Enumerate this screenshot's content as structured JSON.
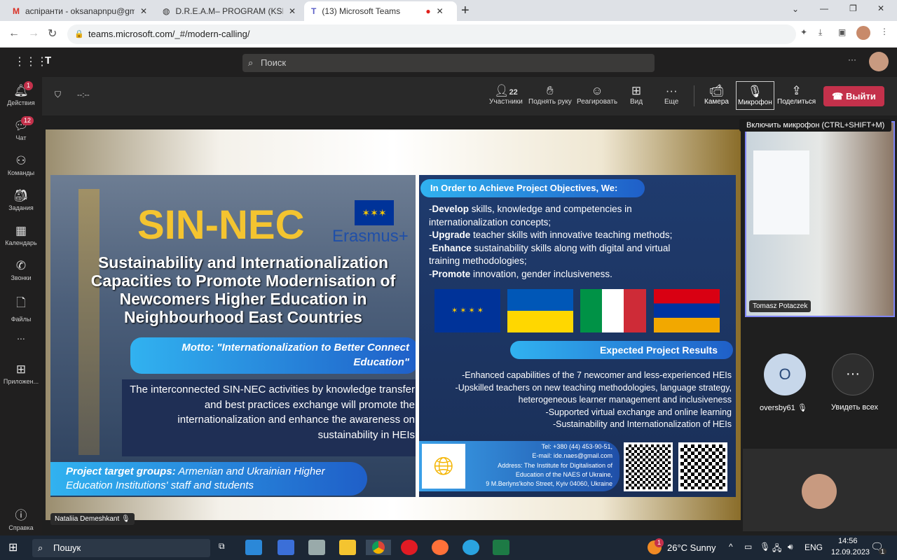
{
  "browser": {
    "tabs": [
      {
        "label": "аспіранти - oksanapnpu@gmail.",
        "icon": "gmail-icon"
      },
      {
        "label": "D.R.E.A.M– PROGRAM (KSIĄŻECZ",
        "icon": "globe-icon"
      },
      {
        "label": "(13) Microsoft Teams",
        "icon": "teams-icon",
        "active": true
      }
    ],
    "url": "teams.microsoft.com/_#/modern-calling/"
  },
  "teams": {
    "search_placeholder": "Поиск",
    "rail": [
      {
        "label": "Действия",
        "badge": "1"
      },
      {
        "label": "Чат",
        "badge": "12"
      },
      {
        "label": "Команды"
      },
      {
        "label": "Задания"
      },
      {
        "label": "Календарь"
      },
      {
        "label": "Звонки"
      },
      {
        "label": "Файлы"
      },
      {
        "label": "..."
      },
      {
        "label": "Приложен..."
      },
      {
        "label": "Справка"
      }
    ],
    "timer": "--:--",
    "toolbar": {
      "participants_count": "22",
      "participants": "Участники",
      "raise_hand": "Поднять руку",
      "react": "Реагировать",
      "view": "Вид",
      "more": "Еще",
      "camera": "Камера",
      "mic": "Микрофон",
      "share": "Поделиться",
      "leave": "Выйти"
    },
    "tooltip": "Включить микрофон (CTRL+SHIFT+M)",
    "presenter": "Nataliia Demeshkant",
    "participants": {
      "video_name": "Tomasz Potaczek",
      "avatar_initial": "O",
      "avatar_name": "oversby61",
      "see_all": "Увидеть всех"
    }
  },
  "slide": {
    "title": "SIN-NEC",
    "erasmus": "Erasmus+",
    "subtitle": "Sustainability and Internationalization Capacities to Promote Modernisation of Newcomers Higher Education in Neighbourhood  East Countries",
    "motto": "Motto: \"Internationalization to Better Connect Education\"",
    "description": "The interconnected SIN-NEC activities by knowledge transfer and best practices exchange will promote the internationalization and enhance the awareness on sustainability in HEIs",
    "target_label": "Project target groups:",
    "target_text": " Armenian and Ukrainian Higher Education Institutions' staff and students",
    "objectives_title": "In Order to Achieve Project Objectives, We:",
    "objectives": [
      {
        "bold": "Develop",
        "text": " skills, knowledge and competencies in internationalization concepts;"
      },
      {
        "bold": "Upgrade",
        "text": " teacher skills with innovative teaching methods;"
      },
      {
        "bold": "Enhance",
        "text": " sustainability skills along with digital and virtual training methodologies;"
      },
      {
        "bold": "Promote",
        "text": " innovation, gender inclusiveness."
      }
    ],
    "results_title": "Expected Project Results",
    "results": [
      "-Enhanced capabilities of the 7 newcomer and less-experienced HEIs",
      "-Upskilled teachers on new teaching methodologies, language strategy, heterogeneous learner management and inclusiveness",
      "-Supported virtual exchange and online learning",
      "-Sustainability and Internationalization of HEIs"
    ],
    "contact": [
      "Tel: +380 (44) 453-90-51,",
      "E-mail: ide.naes@gmail.com",
      "Address: The Institute for Digitalisation of",
      "Education of the NAES of Ukraine,",
      "9 M.Berlyns'koho Street, Kyiv 04060, Ukraine"
    ]
  },
  "taskbar": {
    "search": "Пошук",
    "weather": "26°C  Sunny",
    "weather_badge": "1",
    "lang": "ENG",
    "time": "14:56",
    "date": "12.09.2023",
    "notif": "1"
  }
}
